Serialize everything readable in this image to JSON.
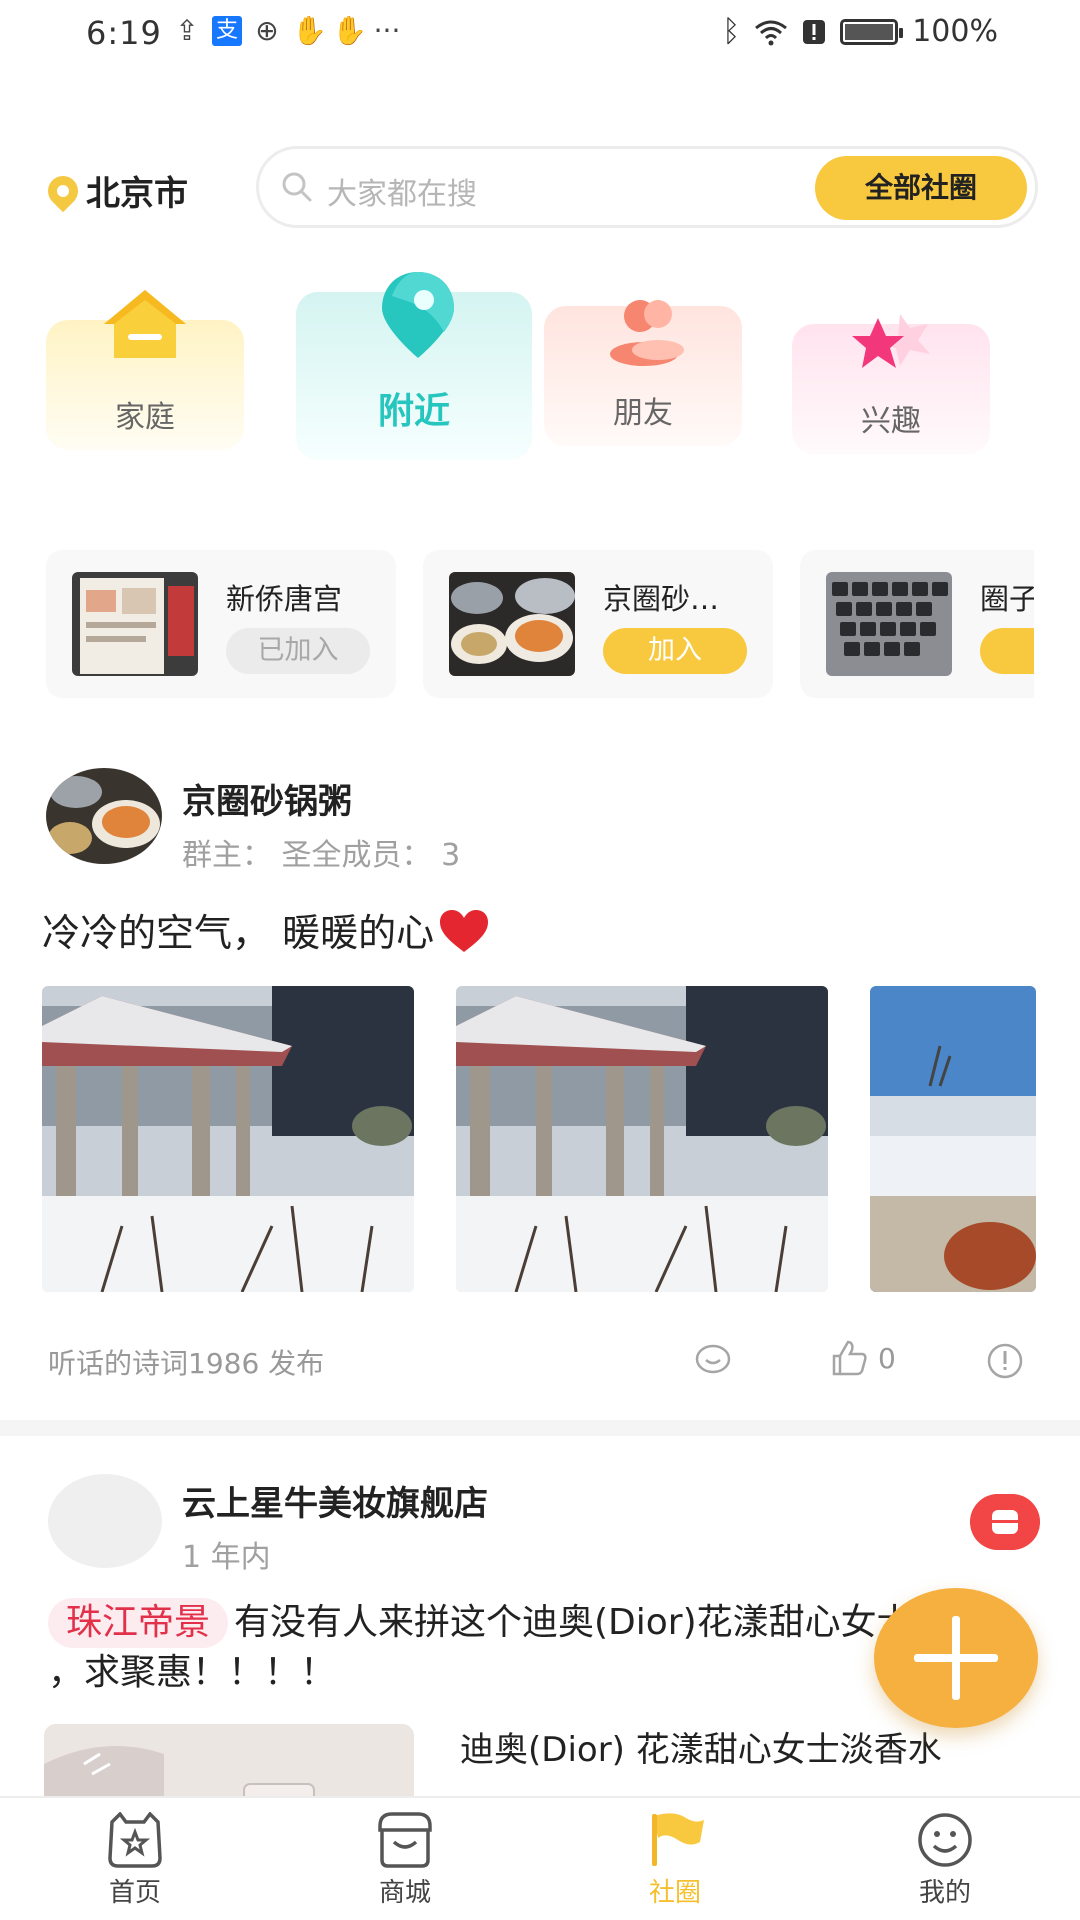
{
  "status_bar": {
    "time": "6:19",
    "left_icons": [
      "upload-icon",
      "alipay-icon",
      "globe-icon",
      "hand-icon",
      "hand-icon",
      "more-dots"
    ],
    "alipay_glyph": "支",
    "more": "···",
    "battery": "100%",
    "battery_level": 1.0
  },
  "header": {
    "city": "北京市",
    "search_placeholder": "大家都在搜",
    "all_circles_button": "全部社圈"
  },
  "categories": [
    {
      "label": "家庭",
      "icon": "house-icon"
    },
    {
      "label": "附近",
      "icon": "location-pin-icon",
      "active": true
    },
    {
      "label": "朋友",
      "icon": "people-icon"
    },
    {
      "label": "兴趣",
      "icon": "star-icon"
    }
  ],
  "groups": [
    {
      "name": "新侨唐宫",
      "button": "已加入"
    },
    {
      "name": "京圈砂…",
      "button": "加入"
    },
    {
      "name": "圈子",
      "button": "加"
    }
  ],
  "post1": {
    "group_name": "京圈砂锅粥",
    "meta": "群主：  圣全成员：  3",
    "text": "冷冷的空气，  暖暖的心",
    "author": "听话的诗词1986 发布",
    "likes": "0"
  },
  "post2": {
    "shop_name": "云上星牛美妆旗舰店",
    "time": "1 年内",
    "tag": "珠江帝景",
    "text": "有没有人来拼这个迪奥(Dior)花漾甜心女士淡香水 ，求聚惠！！！！",
    "product_title": "迪奥(Dior) 花漾甜心女士淡香水"
  },
  "bottom_nav": [
    {
      "label": "首页",
      "icon": "home-icon"
    },
    {
      "label": "商城",
      "icon": "shop-icon"
    },
    {
      "label": "社圈",
      "icon": "flag-icon",
      "active": true
    },
    {
      "label": "我的",
      "icon": "smiley-icon"
    }
  ],
  "colors": {
    "accent_yellow": "#f8c93f",
    "nearby_teal": "#26c5be",
    "tag_red": "#e2304a",
    "fab_orange": "#f5b040"
  }
}
